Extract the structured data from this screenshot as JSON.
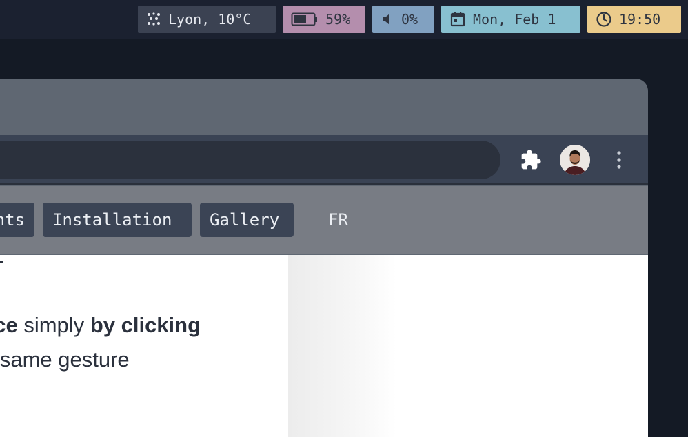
{
  "statusbar": {
    "weather": "Lyon, 10°C",
    "battery": "59%",
    "volume": "0%",
    "date": "Mon, Feb 1",
    "clock": "19:50",
    "colors": {
      "weather_bg": "#3b4252",
      "battery_bg": "#b48ead",
      "volume_bg": "#81a1c1",
      "date_bg": "#88c0d0",
      "clock_bg": "#ebcb8b"
    }
  },
  "browser": {
    "icons": [
      "extensions-icon",
      "profile-avatar",
      "menu-dots-icon"
    ]
  },
  "site_nav": {
    "items": [
      {
        "label": "nts"
      },
      {
        "label": "Installation"
      },
      {
        "label": "Gallery"
      },
      {
        "label": "FR"
      }
    ]
  },
  "content": {
    "line1": {
      "part1": "ace",
      "part2": " simply ",
      "part3": "by clicking"
    },
    "line2": "e same gesture"
  }
}
